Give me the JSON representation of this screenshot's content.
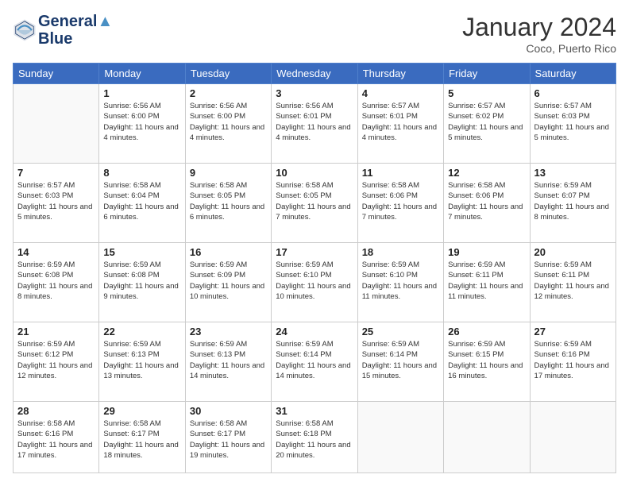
{
  "logo": {
    "line1": "General",
    "line2": "Blue"
  },
  "title": "January 2024",
  "subtitle": "Coco, Puerto Rico",
  "weekdays": [
    "Sunday",
    "Monday",
    "Tuesday",
    "Wednesday",
    "Thursday",
    "Friday",
    "Saturday"
  ],
  "weeks": [
    [
      {
        "day": "",
        "info": ""
      },
      {
        "day": "1",
        "info": "Sunrise: 6:56 AM\nSunset: 6:00 PM\nDaylight: 11 hours and 4 minutes."
      },
      {
        "day": "2",
        "info": "Sunrise: 6:56 AM\nSunset: 6:00 PM\nDaylight: 11 hours and 4 minutes."
      },
      {
        "day": "3",
        "info": "Sunrise: 6:56 AM\nSunset: 6:01 PM\nDaylight: 11 hours and 4 minutes."
      },
      {
        "day": "4",
        "info": "Sunrise: 6:57 AM\nSunset: 6:01 PM\nDaylight: 11 hours and 4 minutes."
      },
      {
        "day": "5",
        "info": "Sunrise: 6:57 AM\nSunset: 6:02 PM\nDaylight: 11 hours and 5 minutes."
      },
      {
        "day": "6",
        "info": "Sunrise: 6:57 AM\nSunset: 6:03 PM\nDaylight: 11 hours and 5 minutes."
      }
    ],
    [
      {
        "day": "7",
        "info": "Sunrise: 6:57 AM\nSunset: 6:03 PM\nDaylight: 11 hours and 5 minutes."
      },
      {
        "day": "8",
        "info": "Sunrise: 6:58 AM\nSunset: 6:04 PM\nDaylight: 11 hours and 6 minutes."
      },
      {
        "day": "9",
        "info": "Sunrise: 6:58 AM\nSunset: 6:05 PM\nDaylight: 11 hours and 6 minutes."
      },
      {
        "day": "10",
        "info": "Sunrise: 6:58 AM\nSunset: 6:05 PM\nDaylight: 11 hours and 7 minutes."
      },
      {
        "day": "11",
        "info": "Sunrise: 6:58 AM\nSunset: 6:06 PM\nDaylight: 11 hours and 7 minutes."
      },
      {
        "day": "12",
        "info": "Sunrise: 6:58 AM\nSunset: 6:06 PM\nDaylight: 11 hours and 7 minutes."
      },
      {
        "day": "13",
        "info": "Sunrise: 6:59 AM\nSunset: 6:07 PM\nDaylight: 11 hours and 8 minutes."
      }
    ],
    [
      {
        "day": "14",
        "info": "Sunrise: 6:59 AM\nSunset: 6:08 PM\nDaylight: 11 hours and 8 minutes."
      },
      {
        "day": "15",
        "info": "Sunrise: 6:59 AM\nSunset: 6:08 PM\nDaylight: 11 hours and 9 minutes."
      },
      {
        "day": "16",
        "info": "Sunrise: 6:59 AM\nSunset: 6:09 PM\nDaylight: 11 hours and 10 minutes."
      },
      {
        "day": "17",
        "info": "Sunrise: 6:59 AM\nSunset: 6:10 PM\nDaylight: 11 hours and 10 minutes."
      },
      {
        "day": "18",
        "info": "Sunrise: 6:59 AM\nSunset: 6:10 PM\nDaylight: 11 hours and 11 minutes."
      },
      {
        "day": "19",
        "info": "Sunrise: 6:59 AM\nSunset: 6:11 PM\nDaylight: 11 hours and 11 minutes."
      },
      {
        "day": "20",
        "info": "Sunrise: 6:59 AM\nSunset: 6:11 PM\nDaylight: 11 hours and 12 minutes."
      }
    ],
    [
      {
        "day": "21",
        "info": "Sunrise: 6:59 AM\nSunset: 6:12 PM\nDaylight: 11 hours and 12 minutes."
      },
      {
        "day": "22",
        "info": "Sunrise: 6:59 AM\nSunset: 6:13 PM\nDaylight: 11 hours and 13 minutes."
      },
      {
        "day": "23",
        "info": "Sunrise: 6:59 AM\nSunset: 6:13 PM\nDaylight: 11 hours and 14 minutes."
      },
      {
        "day": "24",
        "info": "Sunrise: 6:59 AM\nSunset: 6:14 PM\nDaylight: 11 hours and 14 minutes."
      },
      {
        "day": "25",
        "info": "Sunrise: 6:59 AM\nSunset: 6:14 PM\nDaylight: 11 hours and 15 minutes."
      },
      {
        "day": "26",
        "info": "Sunrise: 6:59 AM\nSunset: 6:15 PM\nDaylight: 11 hours and 16 minutes."
      },
      {
        "day": "27",
        "info": "Sunrise: 6:59 AM\nSunset: 6:16 PM\nDaylight: 11 hours and 17 minutes."
      }
    ],
    [
      {
        "day": "28",
        "info": "Sunrise: 6:58 AM\nSunset: 6:16 PM\nDaylight: 11 hours and 17 minutes."
      },
      {
        "day": "29",
        "info": "Sunrise: 6:58 AM\nSunset: 6:17 PM\nDaylight: 11 hours and 18 minutes."
      },
      {
        "day": "30",
        "info": "Sunrise: 6:58 AM\nSunset: 6:17 PM\nDaylight: 11 hours and 19 minutes."
      },
      {
        "day": "31",
        "info": "Sunrise: 6:58 AM\nSunset: 6:18 PM\nDaylight: 11 hours and 20 minutes."
      },
      {
        "day": "",
        "info": ""
      },
      {
        "day": "",
        "info": ""
      },
      {
        "day": "",
        "info": ""
      }
    ]
  ]
}
